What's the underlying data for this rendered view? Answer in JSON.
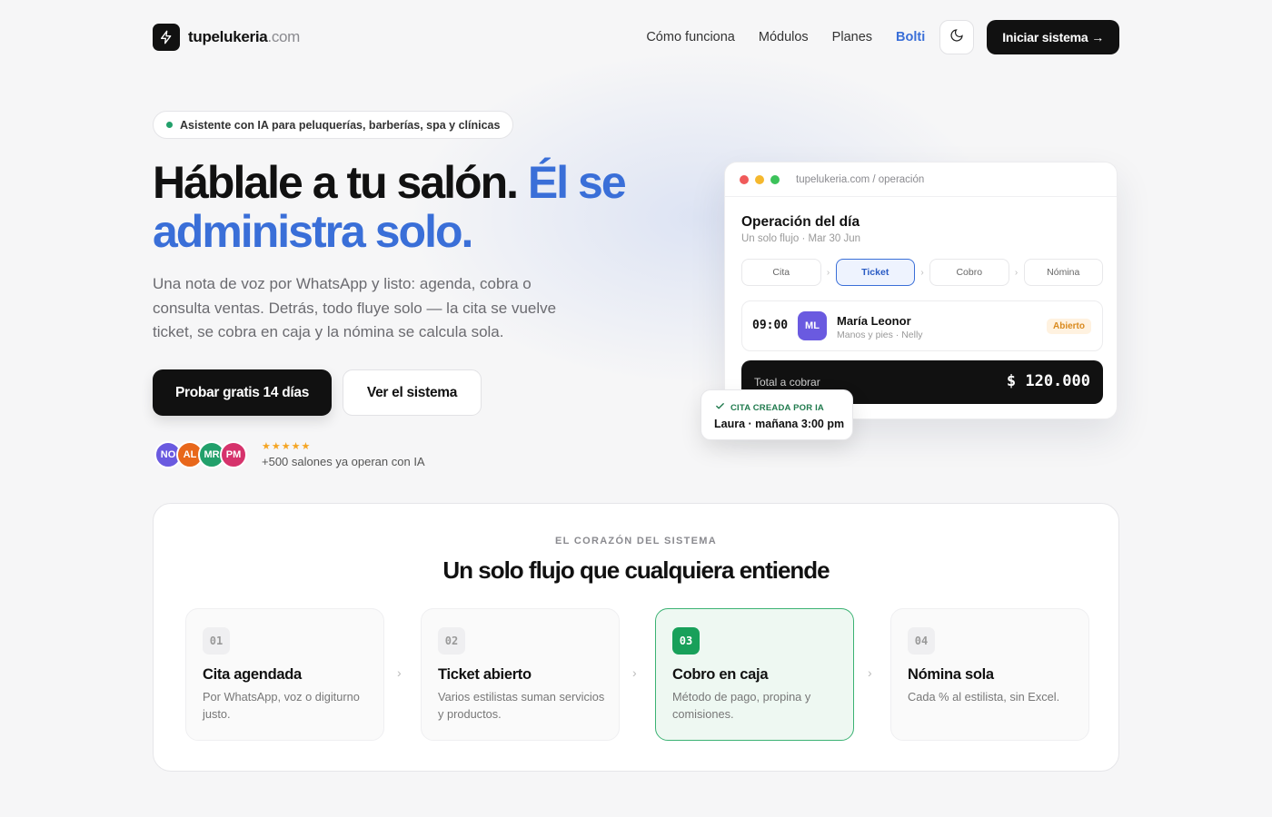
{
  "brand": {
    "name": "tupelukeria",
    "tld": ".com"
  },
  "nav": {
    "links": [
      "Cómo funciona",
      "Módulos",
      "Planes",
      "Bolti"
    ],
    "cta": "Iniciar sistema →"
  },
  "hero": {
    "badge": "Asistente con IA para peluquerías, barberías, spa y clínicas",
    "headline_dark": "Háblale a tu salón. ",
    "headline_blue": "Él se administra solo.",
    "subtitle": "Una nota de voz por WhatsApp y listo: agenda, cobra o consulta ventas. Detrás, todo fluye solo — la cita se vuelve ticket, se cobra en caja y la nómina se calcula sola.",
    "primary_button": "Probar gratis 14 días",
    "secondary_button": "Ver el sistema",
    "avatars": [
      {
        "initials": "NO",
        "color": "#6a5ae0"
      },
      {
        "initials": "AL",
        "color": "#e8671b"
      },
      {
        "initials": "MR",
        "color": "#22a06b"
      },
      {
        "initials": "PM",
        "color": "#d6336c"
      }
    ],
    "stars": "★★★★★",
    "social_proof": "+500 salones ya operan con IA"
  },
  "mock": {
    "url": "tupelukeria.com / operación",
    "title": "Operación del día",
    "subtitle": "Un solo flujo · Mar 30 Jun",
    "steps": [
      "Cita",
      "Ticket",
      "Cobro",
      "Nómina"
    ],
    "appointment": {
      "time": "09:00",
      "initials": "ML",
      "name": "María Leonor",
      "detail": "Manos y pies · Nelly",
      "status": "Abierto"
    },
    "total_label": "Total a cobrar",
    "total_amount": "$ 120.000",
    "toast_top": "CITA CREADA POR IA",
    "toast_main": "Laura · mañana 3:00 pm"
  },
  "section": {
    "kicker": "EL CORAZÓN DEL SISTEMA",
    "title": "Un solo flujo que cualquiera entiende",
    "cards": [
      {
        "num": "01",
        "title": "Cita agendada",
        "desc": "Por WhatsApp, voz o digiturno justo."
      },
      {
        "num": "02",
        "title": "Ticket abierto",
        "desc": "Varios estilistas suman servicios y productos."
      },
      {
        "num": "03",
        "title": "Cobro en caja",
        "desc": "Método de pago, propina y comisiones."
      },
      {
        "num": "04",
        "title": "Nómina sola",
        "desc": "Cada % al estilista, sin Excel."
      }
    ]
  }
}
